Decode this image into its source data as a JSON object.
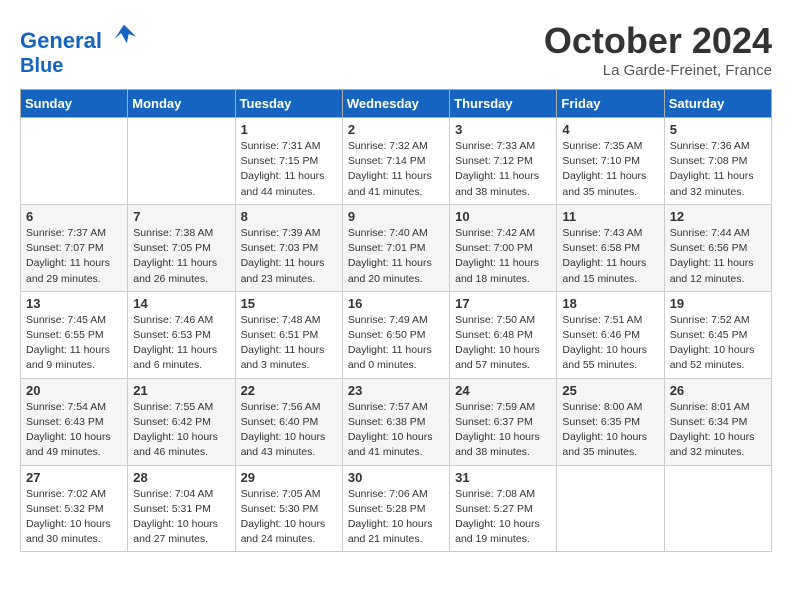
{
  "header": {
    "logo_line1": "General",
    "logo_line2": "Blue",
    "month_title": "October 2024",
    "location": "La Garde-Freinet, France"
  },
  "days_of_week": [
    "Sunday",
    "Monday",
    "Tuesday",
    "Wednesday",
    "Thursday",
    "Friday",
    "Saturday"
  ],
  "weeks": [
    [
      {
        "num": "",
        "info": ""
      },
      {
        "num": "",
        "info": ""
      },
      {
        "num": "1",
        "info": "Sunrise: 7:31 AM\nSunset: 7:15 PM\nDaylight: 11 hours and 44 minutes."
      },
      {
        "num": "2",
        "info": "Sunrise: 7:32 AM\nSunset: 7:14 PM\nDaylight: 11 hours and 41 minutes."
      },
      {
        "num": "3",
        "info": "Sunrise: 7:33 AM\nSunset: 7:12 PM\nDaylight: 11 hours and 38 minutes."
      },
      {
        "num": "4",
        "info": "Sunrise: 7:35 AM\nSunset: 7:10 PM\nDaylight: 11 hours and 35 minutes."
      },
      {
        "num": "5",
        "info": "Sunrise: 7:36 AM\nSunset: 7:08 PM\nDaylight: 11 hours and 32 minutes."
      }
    ],
    [
      {
        "num": "6",
        "info": "Sunrise: 7:37 AM\nSunset: 7:07 PM\nDaylight: 11 hours and 29 minutes."
      },
      {
        "num": "7",
        "info": "Sunrise: 7:38 AM\nSunset: 7:05 PM\nDaylight: 11 hours and 26 minutes."
      },
      {
        "num": "8",
        "info": "Sunrise: 7:39 AM\nSunset: 7:03 PM\nDaylight: 11 hours and 23 minutes."
      },
      {
        "num": "9",
        "info": "Sunrise: 7:40 AM\nSunset: 7:01 PM\nDaylight: 11 hours and 20 minutes."
      },
      {
        "num": "10",
        "info": "Sunrise: 7:42 AM\nSunset: 7:00 PM\nDaylight: 11 hours and 18 minutes."
      },
      {
        "num": "11",
        "info": "Sunrise: 7:43 AM\nSunset: 6:58 PM\nDaylight: 11 hours and 15 minutes."
      },
      {
        "num": "12",
        "info": "Sunrise: 7:44 AM\nSunset: 6:56 PM\nDaylight: 11 hours and 12 minutes."
      }
    ],
    [
      {
        "num": "13",
        "info": "Sunrise: 7:45 AM\nSunset: 6:55 PM\nDaylight: 11 hours and 9 minutes."
      },
      {
        "num": "14",
        "info": "Sunrise: 7:46 AM\nSunset: 6:53 PM\nDaylight: 11 hours and 6 minutes."
      },
      {
        "num": "15",
        "info": "Sunrise: 7:48 AM\nSunset: 6:51 PM\nDaylight: 11 hours and 3 minutes."
      },
      {
        "num": "16",
        "info": "Sunrise: 7:49 AM\nSunset: 6:50 PM\nDaylight: 11 hours and 0 minutes."
      },
      {
        "num": "17",
        "info": "Sunrise: 7:50 AM\nSunset: 6:48 PM\nDaylight: 10 hours and 57 minutes."
      },
      {
        "num": "18",
        "info": "Sunrise: 7:51 AM\nSunset: 6:46 PM\nDaylight: 10 hours and 55 minutes."
      },
      {
        "num": "19",
        "info": "Sunrise: 7:52 AM\nSunset: 6:45 PM\nDaylight: 10 hours and 52 minutes."
      }
    ],
    [
      {
        "num": "20",
        "info": "Sunrise: 7:54 AM\nSunset: 6:43 PM\nDaylight: 10 hours and 49 minutes."
      },
      {
        "num": "21",
        "info": "Sunrise: 7:55 AM\nSunset: 6:42 PM\nDaylight: 10 hours and 46 minutes."
      },
      {
        "num": "22",
        "info": "Sunrise: 7:56 AM\nSunset: 6:40 PM\nDaylight: 10 hours and 43 minutes."
      },
      {
        "num": "23",
        "info": "Sunrise: 7:57 AM\nSunset: 6:38 PM\nDaylight: 10 hours and 41 minutes."
      },
      {
        "num": "24",
        "info": "Sunrise: 7:59 AM\nSunset: 6:37 PM\nDaylight: 10 hours and 38 minutes."
      },
      {
        "num": "25",
        "info": "Sunrise: 8:00 AM\nSunset: 6:35 PM\nDaylight: 10 hours and 35 minutes."
      },
      {
        "num": "26",
        "info": "Sunrise: 8:01 AM\nSunset: 6:34 PM\nDaylight: 10 hours and 32 minutes."
      }
    ],
    [
      {
        "num": "27",
        "info": "Sunrise: 7:02 AM\nSunset: 5:32 PM\nDaylight: 10 hours and 30 minutes."
      },
      {
        "num": "28",
        "info": "Sunrise: 7:04 AM\nSunset: 5:31 PM\nDaylight: 10 hours and 27 minutes."
      },
      {
        "num": "29",
        "info": "Sunrise: 7:05 AM\nSunset: 5:30 PM\nDaylight: 10 hours and 24 minutes."
      },
      {
        "num": "30",
        "info": "Sunrise: 7:06 AM\nSunset: 5:28 PM\nDaylight: 10 hours and 21 minutes."
      },
      {
        "num": "31",
        "info": "Sunrise: 7:08 AM\nSunset: 5:27 PM\nDaylight: 10 hours and 19 minutes."
      },
      {
        "num": "",
        "info": ""
      },
      {
        "num": "",
        "info": ""
      }
    ]
  ]
}
